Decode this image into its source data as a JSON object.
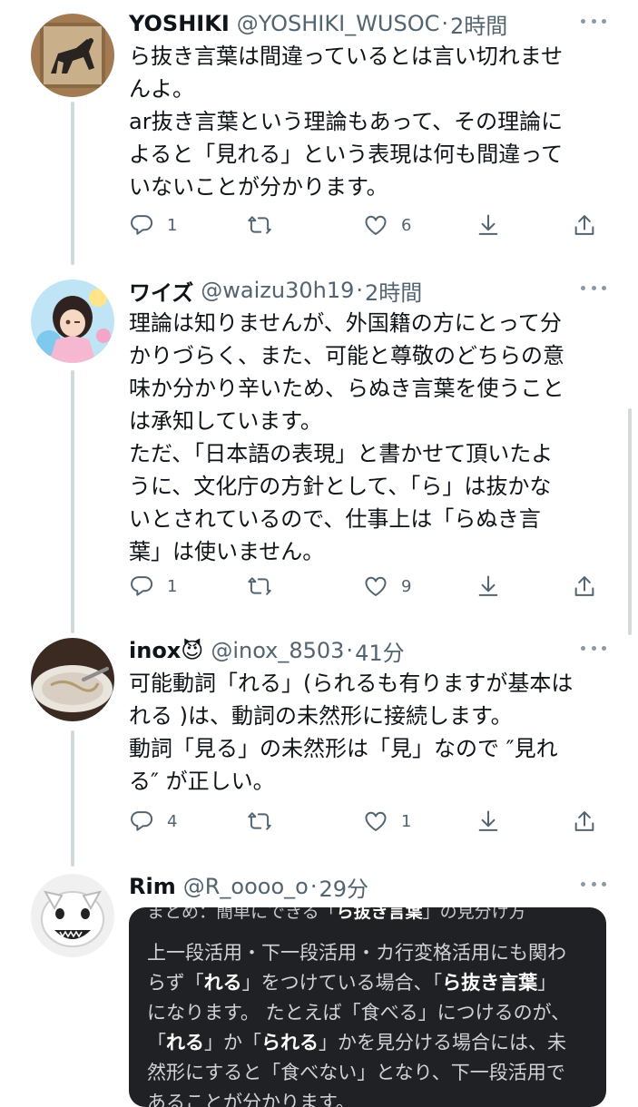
{
  "tweets": [
    {
      "name": "YOSHIKI",
      "handle": "@YOSHIKI_WUSOC",
      "time": "2時間",
      "lines": [
        "ら抜き言葉は間違っているとは言い切れませ",
        "んよ。",
        "ar抜き言葉という理論もあって、その理論に",
        "よると「見れる」という表現は何も間違って",
        "いないことが分かります。"
      ],
      "reply_count": "1",
      "retweet_count": "",
      "like_count": "6"
    },
    {
      "name": "ワイズ",
      "handle": "@waizu30h19",
      "time": "2時間",
      "lines": [
        "理論は知りませんが、外国籍の方にとって分",
        "かりづらく、また、可能と尊敬のどちらの意",
        "味か分かり辛いため、らぬき言葉を使うこと",
        "は承知しています。",
        "ただ、「日本語の表現」と書かせて頂いたよ",
        "うに、文化庁の方針として、「ら」は抜かな",
        "いとされているので、仕事上は「らぬき言",
        "葉」は使いません。"
      ],
      "reply_count": "1",
      "retweet_count": "",
      "like_count": "9"
    },
    {
      "name": "inox😈",
      "handle": "@inox_8503",
      "time": "41分",
      "lines": [
        "可能動詞「れる」(られるも有りますが基本は",
        "れる )は、動詞の未然形に接続します。",
        "動詞「見る」の未然形は「見」なので ″見れ",
        "る″ が正しい。"
      ],
      "reply_count": "4",
      "retweet_count": "",
      "like_count": "1"
    },
    {
      "name": "Rim",
      "handle": "@R_oooo_o",
      "time": "29分"
    }
  ],
  "embedded_card": {
    "title_prefix": "まとめ：簡単にできる「",
    "title_bold": "ら抜き言葉",
    "title_suffix": "」の見分け方",
    "lines": [
      [
        {
          "t": "上一段活用・下一段活用・カ行変格活用にも関わ",
          "b": false
        }
      ],
      [
        {
          "t": "らず「",
          "b": false
        },
        {
          "t": "れる",
          "b": true
        },
        {
          "t": "」をつけている場合、「",
          "b": false
        },
        {
          "t": "ら抜き言葉",
          "b": true
        },
        {
          "t": "」",
          "b": false
        }
      ],
      [
        {
          "t": "になります。 たとえば「食べる」につけるのが、",
          "b": false
        }
      ],
      [
        {
          "t": "「",
          "b": false
        },
        {
          "t": "れる",
          "b": true
        },
        {
          "t": "」か「",
          "b": false
        },
        {
          "t": "られる",
          "b": true
        },
        {
          "t": "」かを見分ける場合には、未",
          "b": false
        }
      ],
      [
        {
          "t": "然形にすると「食べない」となり、下一段活用で",
          "b": false
        }
      ],
      [
        {
          "t": "あることが分かります。",
          "b": false
        }
      ]
    ]
  },
  "colors": {
    "text": "#0f1419",
    "secondary": "#536471",
    "thread_line": "#cfd9de",
    "card_bg": "#202124"
  },
  "icons": [
    "reply-icon",
    "retweet-icon",
    "like-icon",
    "download-icon",
    "share-icon",
    "more-icon"
  ]
}
